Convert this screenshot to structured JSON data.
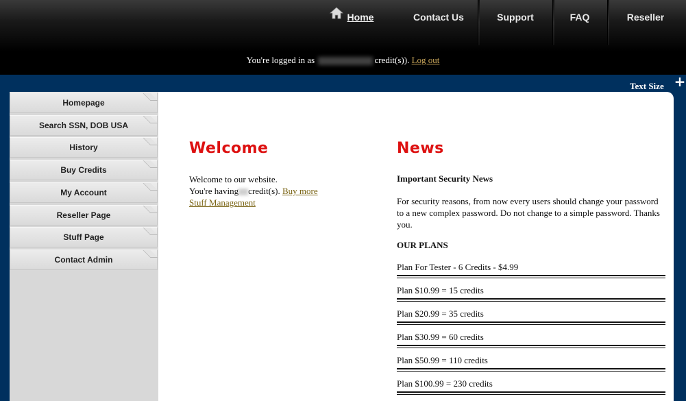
{
  "nav": {
    "home": "Home",
    "contact": "Contact Us",
    "support": "Support",
    "faq": "FAQ",
    "reseller": "Reseller"
  },
  "login": {
    "prefix": "You're logged in as",
    "suffix": "credit(s)).",
    "logout": "Log out"
  },
  "text_size": {
    "label": "Text Size",
    "plus": "+"
  },
  "sidebar": {
    "items": [
      {
        "label": "Homepage"
      },
      {
        "label": "Search SSN, DOB USA"
      },
      {
        "label": "History"
      },
      {
        "label": "Buy Credits"
      },
      {
        "label": "My Account"
      },
      {
        "label": "Reseller Page"
      },
      {
        "label": "Stuff Page"
      },
      {
        "label": "Contact Admin"
      }
    ]
  },
  "welcome": {
    "title": "Welcome",
    "line1": "Welcome to our website.",
    "line2_prefix": "You're having",
    "line2_suffix": "credit(s).",
    "buy_more": "Buy more",
    "stuff_management": "Stuff Management"
  },
  "news": {
    "title": "News",
    "headline": "Important Security News",
    "body": "For security reasons, from now every users should change your password to a new complex password. Do not change to a simple password. Thanks you.",
    "plans_title": "OUR PLANS",
    "plans": [
      "Plan For Tester - 6 Credits - $4.99",
      "Plan $10.99 = 15 credits",
      "Plan $20.99 = 35 credits",
      "Plan $30.99 = 60 credits",
      "Plan $50.99 = 110 credits",
      "Plan $100.99 = 230 credits"
    ]
  },
  "colors": {
    "header_bg": "#000000",
    "page_bg": "#00305e",
    "accent_red": "#dd1111",
    "link": "#7a6414"
  }
}
